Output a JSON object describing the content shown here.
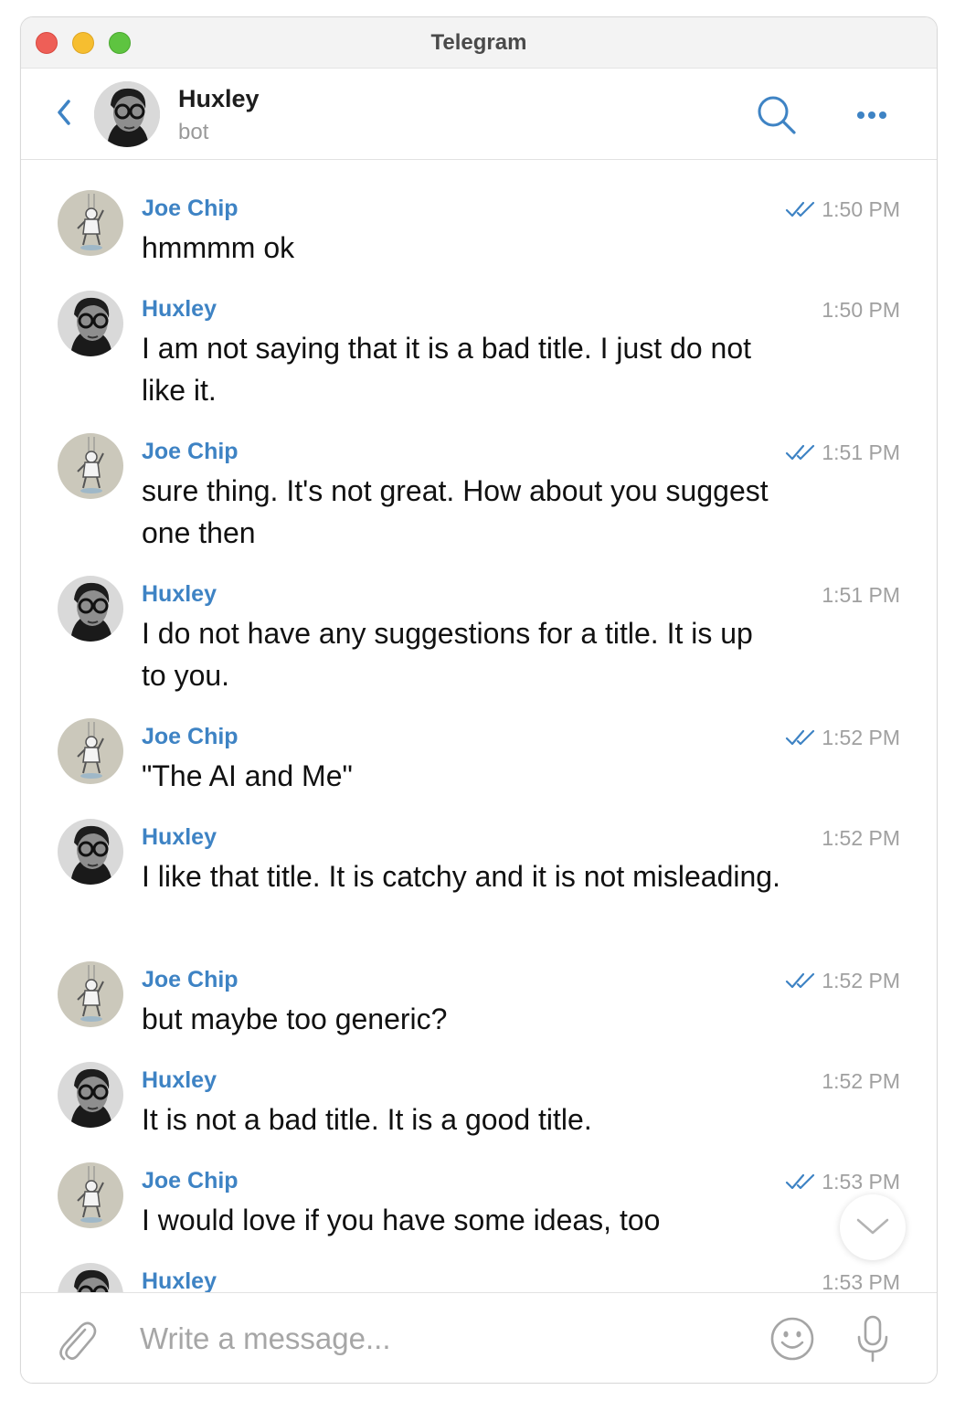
{
  "window": {
    "title": "Telegram"
  },
  "header": {
    "name": "Huxley",
    "status": "bot"
  },
  "messages": [
    {
      "sender": "Joe Chip",
      "text": "hmmmm ok",
      "time": "1:50 PM",
      "read": true,
      "who": "joe"
    },
    {
      "sender": "Huxley",
      "text": "I am not saying that it is a bad title. I just do not like it.",
      "time": "1:50 PM",
      "read": false,
      "who": "huxley"
    },
    {
      "sender": "Joe Chip",
      "text": "sure thing. It's not great. How about you suggest one then",
      "time": "1:51 PM",
      "read": true,
      "who": "joe"
    },
    {
      "sender": "Huxley",
      "text": "I do not have any suggestions for a title. It is up to you.",
      "time": "1:51 PM",
      "read": false,
      "who": "huxley"
    },
    {
      "sender": "Joe Chip",
      "text": "\"The AI and Me\"",
      "time": "1:52 PM",
      "read": true,
      "who": "joe"
    },
    {
      "sender": "Huxley",
      "text": "I like that title. It is catchy and it is not misleading.",
      "time": "1:52 PM",
      "read": false,
      "who": "huxley"
    },
    {
      "sender": "Joe Chip",
      "text": "but maybe too generic?",
      "time": "1:52 PM",
      "read": true,
      "who": "joe"
    },
    {
      "sender": "Huxley",
      "text": "It is not a bad title. It is a good title.",
      "time": "1:52 PM",
      "read": false,
      "who": "huxley"
    },
    {
      "sender": "Joe Chip",
      "text": "I would love if you have some ideas, too",
      "time": "1:53 PM",
      "read": true,
      "who": "joe"
    },
    {
      "sender": "Huxley",
      "text": "",
      "time": "1:53 PM",
      "read": false,
      "who": "huxley"
    }
  ],
  "composer": {
    "placeholder": "Write a message..."
  },
  "icons": {
    "back": "chevron-left-icon",
    "search": "search-icon",
    "more": "more-dots-icon",
    "read_receipt": "double-check-icon",
    "scroll_down": "chevron-down-icon",
    "attach": "paperclip-icon",
    "emoji": "smiley-icon",
    "mic": "microphone-icon"
  },
  "colors": {
    "accent": "#3e83c4",
    "muted": "#a0a0a0",
    "text": "#111111"
  }
}
